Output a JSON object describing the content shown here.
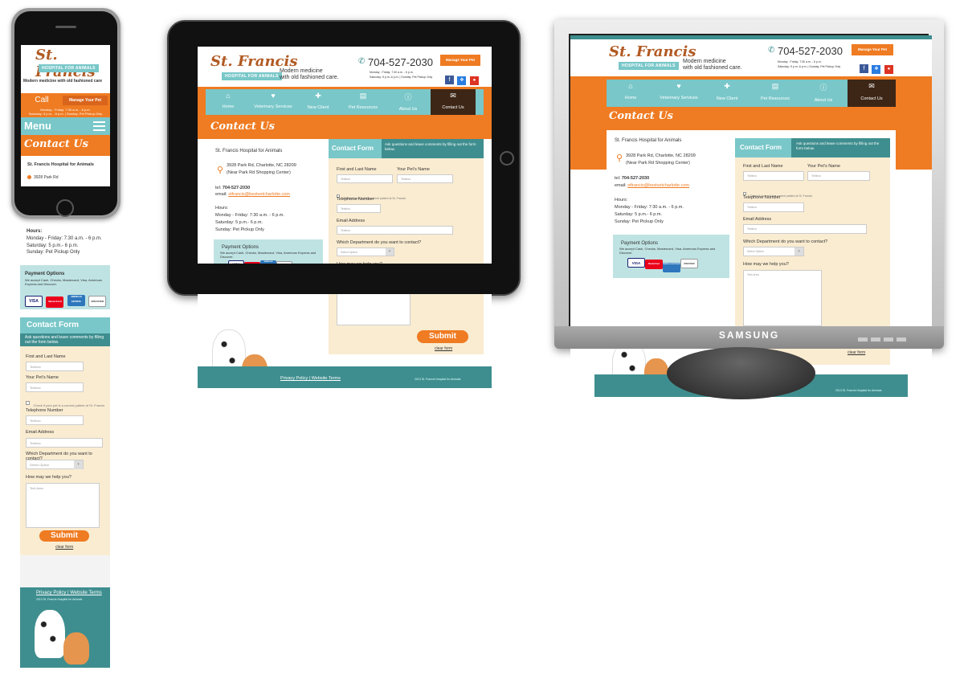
{
  "brand": {
    "name": "St. Francis",
    "tag": "HOSPITAL FOR ANIMALS",
    "slogan_1": "Modern medicine",
    "slogan_2": "with old fashioned care.",
    "slogan_mobile": "Modern medicine with old fashioned care",
    "phone": "704-527-2030",
    "manage": "Manage Your Pet",
    "hours_small_1": "Monday - Friday: 7:30 a.m. - 6 p.m.",
    "hours_small_2": "Saturday: 5 p.m.-6 p.m. | Sunday: Pet Pickup Only"
  },
  "nav": [
    {
      "label": "Home",
      "icon": "home-icon"
    },
    {
      "label": "Veterinary Services",
      "icon": "heart-icon"
    },
    {
      "label": "New Client",
      "icon": "plus-icon"
    },
    {
      "label": "Pet Resources",
      "icon": "printer-icon"
    },
    {
      "label": "About Us",
      "icon": "info-icon"
    },
    {
      "label": "Contact Us",
      "icon": "mail-icon"
    }
  ],
  "page_title": "Contact Us",
  "contact": {
    "name": "St. Francis Hospital for Animals",
    "addr1": "3928 Park Rd, Charlotte, NC 28209",
    "addr2": "(Near Park Rd Shopping Center)",
    "addr_short": "3928 Park Rd",
    "tel_label": "tel:",
    "tel": "704-527-2030",
    "email_label": "email:",
    "email": "stfrancis@bestvetcharlotte.com",
    "hours_title": "Hours:",
    "hours_1": "Monday - Friday: 7:30 a.m. - 6 p.m.",
    "hours_2": "Saturday: 5 p.m.- 6 p.m.",
    "hours_3": "Sunday: Pet Pickup Only"
  },
  "payment": {
    "title": "Payment Options",
    "text": "We accept Cash, Checks, Mastercard, Visa, American Express and Discover.",
    "cards": [
      "VISA",
      "MasterCard",
      "AMERICAN EXPRESS",
      "DISCOVER"
    ]
  },
  "form": {
    "title": "Contact Form",
    "subtitle": "Ask questions and leave comments by filling out the form below.",
    "name_label": "First and Last Name",
    "pet_label": "Your Pet's Name",
    "textbox": "Textbox",
    "check": "Check if your pet is a current patient at St. Francis",
    "phone_label": "Telephone Number",
    "email_label": "Email Address",
    "dept_label": "Which Department do you want to contact?",
    "select": "Select Option",
    "help_label": "How may we help you?",
    "textarea": "Text Area",
    "submit": "Submit",
    "clear": "clear form"
  },
  "footer": {
    "links": "Privacy Policy | Website Terms",
    "copy": "2013 St. Francis Hospital for Animals"
  },
  "mobile": {
    "call": "Call",
    "menu": "Menu",
    "hours_s1": "Monday - Friday: 7:30 a.m. - 6 p.m.",
    "hours_s2": "Saturday: 5 p.m. - 6 p.m. | Sunday: Pet Pickup Only"
  },
  "monitor": {
    "brand": "SAMSUNG"
  },
  "colors": {
    "orange": "#ef7b22",
    "teal": "#79c7c9",
    "brown": "#3d2616",
    "dark_teal": "#3f8e8f",
    "cream": "#faecd1"
  }
}
